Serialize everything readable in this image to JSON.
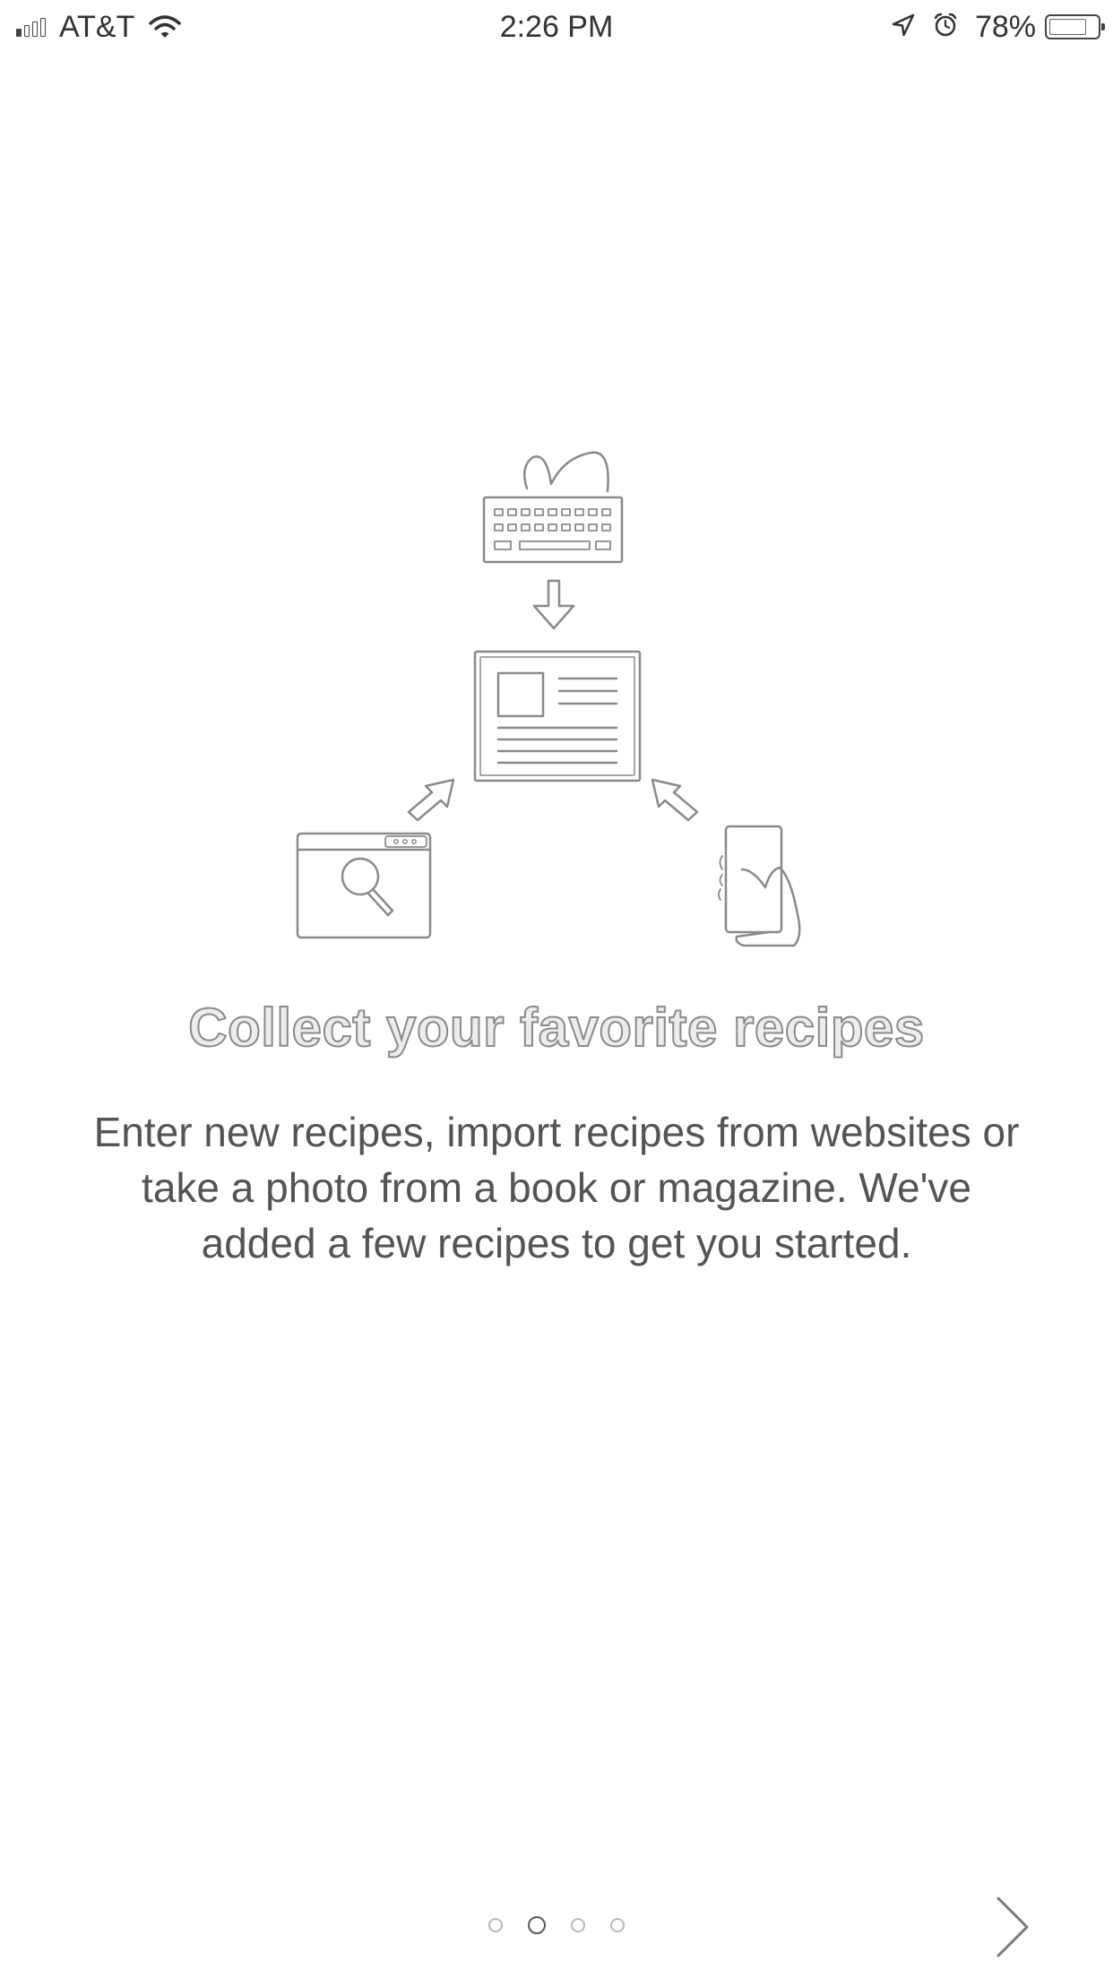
{
  "status_bar": {
    "carrier": "AT&T",
    "time": "2:26 PM",
    "battery_percent": "78%",
    "battery_level": 0.78,
    "signal_bars_filled": 1,
    "icons": [
      "signal-icon",
      "wifi-icon",
      "location-arrow-icon",
      "alarm-icon",
      "battery-icon"
    ]
  },
  "onboarding": {
    "title": "Collect your favorite recipes",
    "body": "Enter new recipes, import recipes from websites or take a photo from a book or magazine. We've added a few recipes to get you started.",
    "illustration_icons": [
      "keyboard-icon",
      "arrow-down-icon",
      "recipe-card-icon",
      "arrow-up-right-icon",
      "arrow-up-left-icon",
      "browser-search-icon",
      "phone-in-hand-icon"
    ]
  },
  "pager": {
    "total_pages": 4,
    "current_page": 2
  },
  "navigation": {
    "next_icon": "chevron-right-icon"
  },
  "colors": {
    "background": "#ffffff",
    "text": "#555555",
    "illustration_stroke": "#8a8a8a"
  }
}
